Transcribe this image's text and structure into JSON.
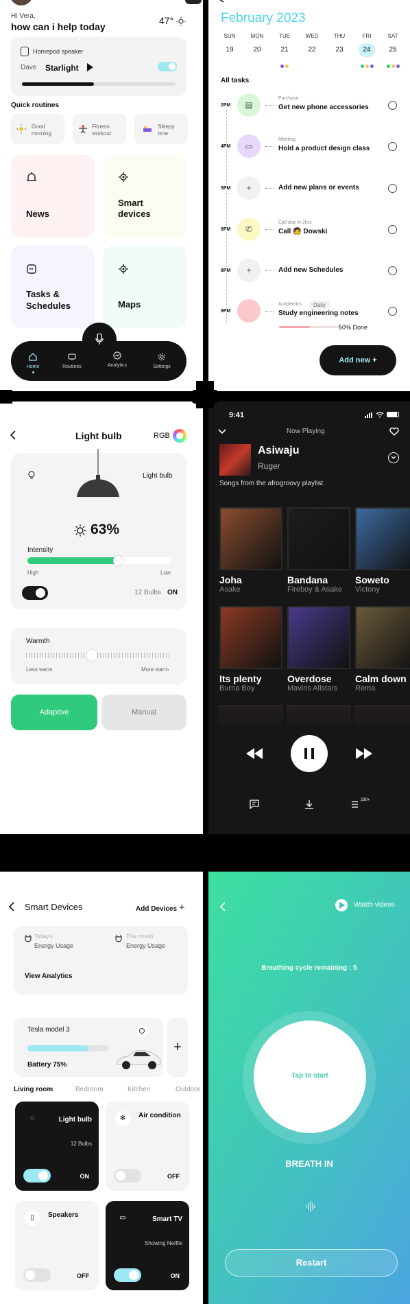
{
  "home": {
    "greeting": "Hi Vera,",
    "heading": "how can i help today",
    "temperature": "47°",
    "speaker": {
      "label": "Homepod speaker",
      "user": "Dave",
      "track": "Starlight",
      "progress": 0.47
    },
    "routines_title": "Quick routines",
    "routines": [
      {
        "label": "Good morning",
        "icon": "sun-icon"
      },
      {
        "label": "Fitness workout",
        "icon": "workout-icon"
      },
      {
        "label": "Sleepy time",
        "icon": "bed-icon"
      }
    ],
    "tiles": [
      {
        "label": "News",
        "icon": "news-icon",
        "bg": "#fdf1f1"
      },
      {
        "label": "Smart devices",
        "icon": "smart-devices-icon",
        "bg": "#fbfcf2"
      },
      {
        "label": "Tasks & Schedules",
        "icon": "tasks-icon",
        "bg": "#f6f4fd"
      },
      {
        "label": "Maps",
        "icon": "maps-icon",
        "bg": "#f1fbf7"
      }
    ],
    "nav": [
      {
        "label": "Home",
        "icon": "home-icon"
      },
      {
        "label": "Routines",
        "icon": "routines-icon"
      },
      {
        "label": "Analytics",
        "icon": "analytics-icon"
      },
      {
        "label": "Settings",
        "icon": "settings-icon"
      }
    ]
  },
  "calendar": {
    "month": "February 2023",
    "days": [
      {
        "name": "SUN",
        "num": "19"
      },
      {
        "name": "MON",
        "num": "20"
      },
      {
        "name": "TUE",
        "num": "21"
      },
      {
        "name": "WED",
        "num": "22"
      },
      {
        "name": "THU",
        "num": "23"
      },
      {
        "name": "FRI",
        "num": "24"
      },
      {
        "name": "SAT",
        "num": "25"
      }
    ],
    "all_tasks": "All tasks",
    "tasks": [
      {
        "time": "2PM",
        "category": "Purchase",
        "title": "Get new phone accessories",
        "color": "#d7f7d7",
        "icon": "card-icon"
      },
      {
        "time": "4PM",
        "category": "Meeting",
        "title": "Hold a product design class",
        "color": "#e6d7fb",
        "icon": "video-icon"
      },
      {
        "time": "5PM",
        "category": "",
        "title": "Add new plans or events",
        "color": "#f1f1f1",
        "icon": "plus-icon"
      },
      {
        "time": "6PM",
        "category": "Call due in 2hrs",
        "title": "Call 🧑 Dowski",
        "color": "#fbf8c4",
        "icon": "phone-icon"
      },
      {
        "time": "8PM",
        "category": "",
        "title": "Add new Schedules",
        "color": "#f1f1f1",
        "icon": "plus-icon"
      },
      {
        "time": "9PM",
        "category": "Academics",
        "title": "Study engineering notes",
        "color": "#fbc9c9",
        "icon": "book-icon"
      }
    ],
    "daily_badge": "Daily",
    "study_progress": "50% Done",
    "add_new": "Add new"
  },
  "bulb": {
    "title": "Light bulb",
    "rgb": "RGB",
    "card_label": "Light bulb",
    "percent": "63%",
    "intensity_label": "Intensity",
    "intensity": 0.63,
    "high": "High",
    "low": "Low",
    "bulbs": "12 Bulbs",
    "on": "ON",
    "warmth_label": "Warmth",
    "less_warm": "Less warm",
    "more_warm": "More warm",
    "adaptive": "Adaptive",
    "manual": "Manual"
  },
  "player": {
    "time": "9:41",
    "header": "Now Playing",
    "track": "Asiwaju",
    "artist": "Ruger",
    "playlist": "Songs from the afrogroovy playlist",
    "albums": [
      {
        "title": "Joha",
        "artist": "Asake",
        "color": "#8a4d2f"
      },
      {
        "title": "Bandana",
        "artist": "Fireboy & Asake",
        "color": "#1c1c1c"
      },
      {
        "title": "Soweto",
        "artist": "Victony",
        "color": "#3d6aa0"
      },
      {
        "title": "Its plenty",
        "artist": "Burna Boy",
        "color": "#8a3a24"
      },
      {
        "title": "Overdose",
        "artist": "Mavins Allstars",
        "color": "#4a3a8a"
      },
      {
        "title": "Calm down",
        "artist": "Rema",
        "color": "#6a5a3a"
      }
    ],
    "queue_count": "230+"
  },
  "devices": {
    "title": "Smart Devices",
    "add": "Add Devices",
    "today_label": "Today's",
    "month_label": "This month",
    "energy": "Energy Usage",
    "view_analytics": "View Analytics",
    "car": "Tesla model 3",
    "battery": "Battery 75%",
    "battery_level": 0.75,
    "rooms": [
      "Living room",
      "Bedroom",
      "Kitchen",
      "Outdoor"
    ],
    "cards": [
      {
        "label": "Light bulb",
        "sub": "12 Bulbs",
        "state": "ON",
        "icon": "bulb-icon",
        "dark": true
      },
      {
        "label": "Air condition",
        "sub": "",
        "state": "OFF",
        "icon": "fan-icon",
        "dark": false
      },
      {
        "label": "Speakers",
        "sub": "",
        "state": "OFF",
        "icon": "speaker-icon",
        "dark": false
      },
      {
        "label": "Smart TV",
        "sub": "Showing Netflix",
        "state": "ON",
        "icon": "tv-icon",
        "dark": true
      }
    ]
  },
  "breath": {
    "watch": "Watch videos",
    "cycle": "Breathing cycle remaining : 5",
    "tap": "Tap to start",
    "instruction": "BREATH IN",
    "restart": "Restart"
  }
}
